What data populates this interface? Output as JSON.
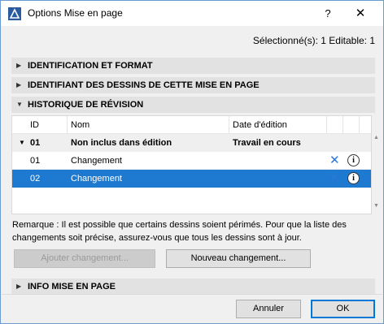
{
  "window": {
    "title": "Options Mise en page",
    "help_label": "?",
    "close_label": "✕"
  },
  "selection_info": "Sélectionné(s): 1 Editable: 1",
  "sections": {
    "identification": "IDENTIFICATION ET FORMAT",
    "identifiant": "IDENTIFIANT DES DESSINS DE CETTE MISE EN PAGE",
    "historique": "HISTORIQUE DE RÉVISION",
    "info": "INFO MISE EN PAGE"
  },
  "table": {
    "headers": {
      "id": "ID",
      "nom": "Nom",
      "date": "Date d'édition"
    },
    "group_row": {
      "id": "01",
      "nom": "Non inclus dans édition",
      "date": "Travail en cours"
    },
    "rows": [
      {
        "id": "01",
        "nom": "Changement"
      },
      {
        "id": "02",
        "nom": "Changement"
      }
    ]
  },
  "remark": "Remarque : Il est possible que certains dessins soient périmés. Pour que la liste des changements soit précise, assurez-vous que tous les dessins sont à jour.",
  "buttons": {
    "ajouter": "Ajouter changement...",
    "nouveau": "Nouveau changement...",
    "annuler": "Annuler",
    "ok": "OK"
  },
  "colors": {
    "accent": "#1e7ad1",
    "icon_blue": "#2b78d6"
  }
}
